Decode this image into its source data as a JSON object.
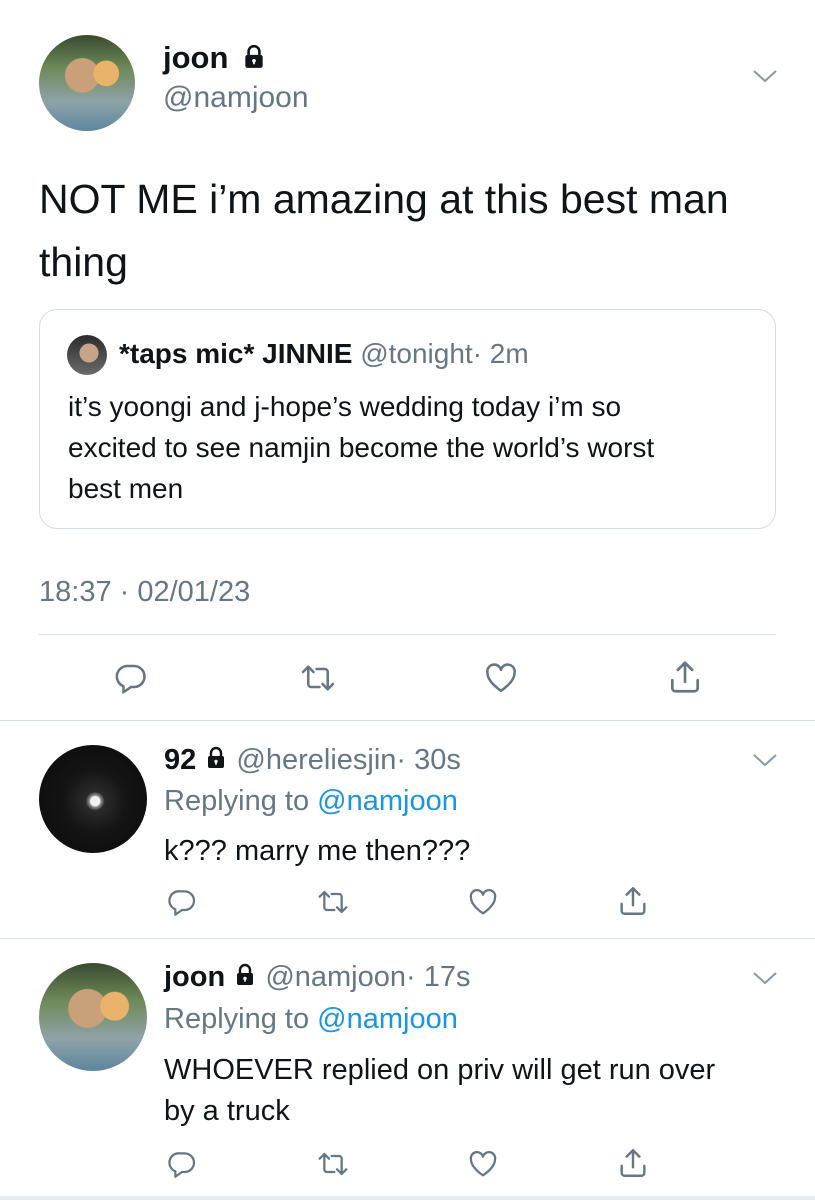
{
  "main_tweet": {
    "display_name": "joon",
    "handle": "@namjoon",
    "text_line1": "NOT ME i’m amazing at this best man",
    "text_line2": "thing",
    "timestamp": "18:37 · 02/01/23",
    "quoted": {
      "display_name": "*taps mic* JINNIE",
      "handle": "@tonight",
      "time": "· 2m",
      "line1": "it’s yoongi and j-hope’s wedding today i’m so",
      "line2": "excited to see namjin become the world’s worst",
      "line3": "best men"
    }
  },
  "replies": [
    {
      "display_name": "92",
      "handle": "@hereliesjin",
      "time": "· 30s",
      "replying_prefix": "Replying to",
      "replying_handle": "@namjoon",
      "line1": "k??? marry me then???",
      "line2": ""
    },
    {
      "display_name": "joon",
      "handle": "@namjoon",
      "time": "· 17s",
      "replying_prefix": "Replying to",
      "replying_handle": "@namjoon",
      "line1": "WHOEVER replied on priv will get run over",
      "line2": "by a truck"
    }
  ],
  "icons": {
    "reply": "reply-icon",
    "retweet": "retweet-icon",
    "like": "heart-icon",
    "share": "share-icon",
    "lock": "lock-icon",
    "chevron": "chevron-down-icon"
  },
  "colors": {
    "text": "#0f1419",
    "secondary": "#657786",
    "link": "#1b95e0",
    "icon": "#657786",
    "divider": "#d7dfe5"
  }
}
